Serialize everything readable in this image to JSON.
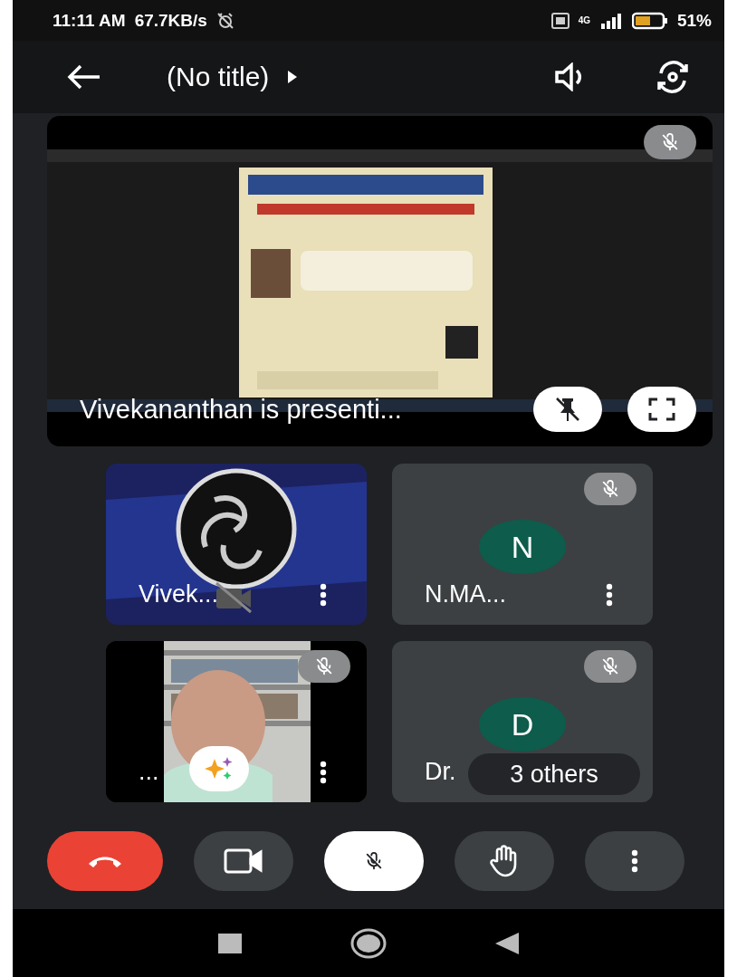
{
  "status_bar": {
    "time": "11:11 AM",
    "speed": "67.7KB/s",
    "network": "4G",
    "battery": "51%"
  },
  "top_bar": {
    "title": "(No title)"
  },
  "presentation": {
    "kind": "picture",
    "muted": true,
    "caption": "Vivekananthan is presenti..."
  },
  "tiles": [
    {
      "kind": "logo",
      "name": "Vivek...",
      "camera_off": true
    },
    {
      "kind": "avatar",
      "name": "N.MA...",
      "initial": "N",
      "muted": true
    },
    {
      "kind": "video",
      "name": "...",
      "muted": true,
      "effects": true
    },
    {
      "kind": "avatar",
      "name": "Dr.",
      "initial": "D",
      "muted": true,
      "overlay": "3 others"
    }
  ],
  "controls": [
    {
      "kind": "end_call"
    },
    {
      "kind": "camera"
    },
    {
      "kind": "mic",
      "muted": true
    },
    {
      "kind": "hand"
    },
    {
      "kind": "more"
    }
  ]
}
